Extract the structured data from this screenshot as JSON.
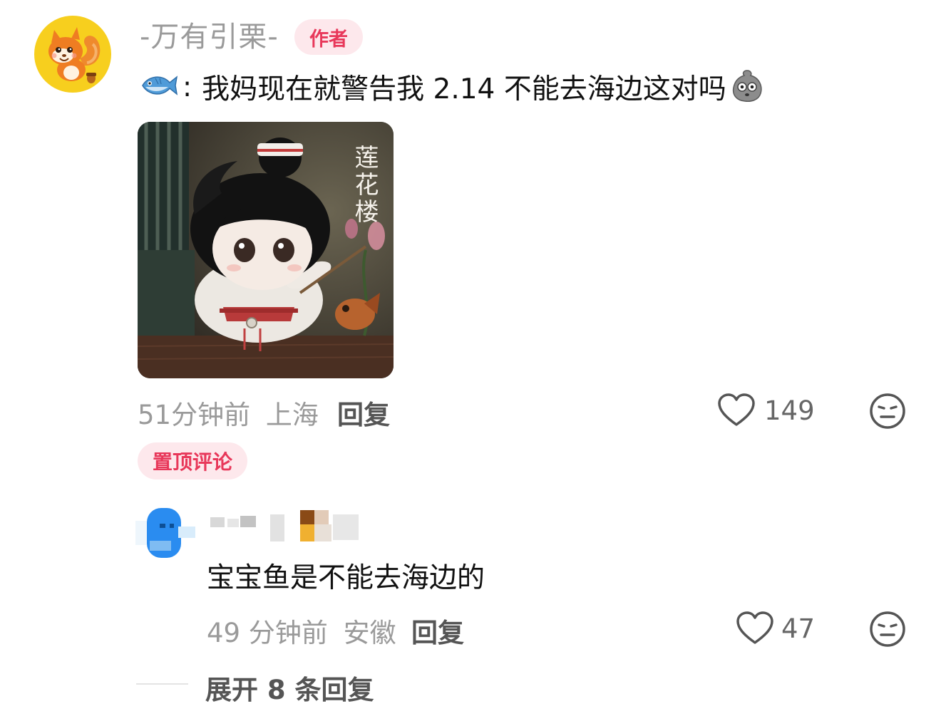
{
  "comment": {
    "username": "-万有引栗-",
    "author_badge": "作者",
    "text": "我妈现在就警告我 2.14 不能去海边这对吗",
    "time": "51分钟前",
    "location": "上海",
    "reply_label": "回复",
    "likes": "149",
    "pinned_label": "置顶评论",
    "image_text": "莲花楼"
  },
  "reply": {
    "text": "宝宝鱼是不能去海边的",
    "time": "49 分钟前",
    "location": "安徽",
    "reply_label": "回复",
    "likes": "47"
  },
  "expand_label": "展开 8 条回复",
  "colors": {
    "accent_pink": "#e8385a",
    "badge_bg": "#fde8ec",
    "muted": "#9a9a9a",
    "avatar_yellow": "#f7cf1e",
    "reply_avatar_blue": "#2a8cf0"
  },
  "icons": [
    "squirrel-avatar",
    "fish-emoji",
    "pebble-face-emoji",
    "heart-icon",
    "neutral-face-icon"
  ]
}
